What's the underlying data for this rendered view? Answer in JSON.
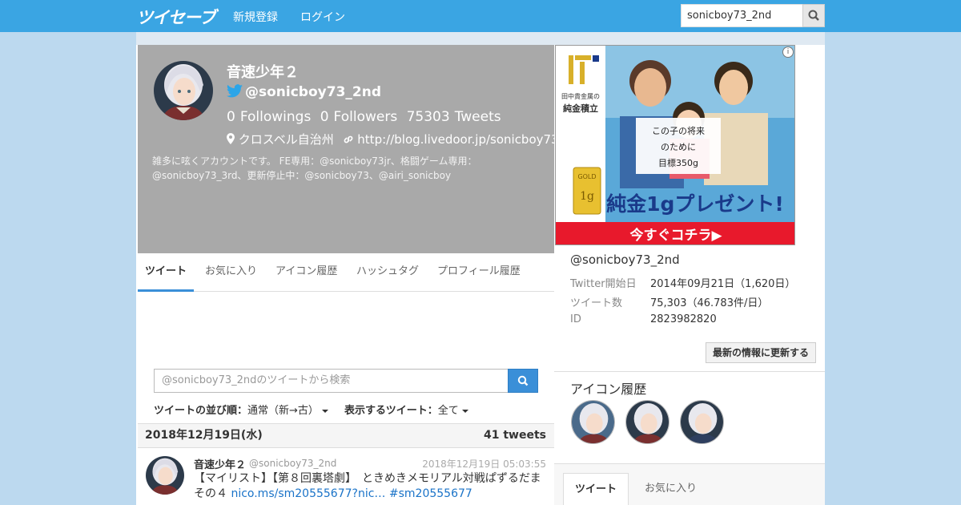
{
  "nav": {
    "brand": "ツイセーブ",
    "links": [
      "新規登録",
      "ログイン"
    ],
    "search_value": "sonicboy73_2nd"
  },
  "profile": {
    "name": "音速少年２",
    "handle": "@sonicboy73_2nd",
    "followings": "0",
    "followings_label": "Followings",
    "followers": "0",
    "followers_label": "Followers",
    "tweets": "75303",
    "tweets_label": "Tweets",
    "location": "クロスベル自治州",
    "url": "http://blog.livedoor.jp/sonicboy73",
    "bio": "雑多に呟くアカウントです。 FE専用：@sonicboy73jr、格闘ゲーム専用：@sonicboy73_3rd、更新停止中：@sonicboy73、@airi_sonicboy"
  },
  "tabs": [
    "ツイート",
    "お気に入り",
    "アイコン履歴",
    "ハッシュタグ",
    "プロフィール履歴"
  ],
  "tweet_search": {
    "placeholder": "@sonicboy73_2ndのツイートから検索"
  },
  "filters": {
    "sort_label": "ツイートの並び順：",
    "sort_value": "通常（新→古）",
    "show_label": "表示するツイート：",
    "show_value": "全て"
  },
  "date_bar": {
    "date": "2018年12月19日(水)",
    "count": "41 tweets"
  },
  "tweet": {
    "name": "音速少年２",
    "handle": "@sonicboy73_2nd",
    "time": "2018年12月19日 05:03:55",
    "text": "【マイリスト】【第８回裏塔劇】　ときめきメモリアル対戦ぱずるだまその４",
    "link1": "nico.ms/sm20555677?nic…",
    "link2": "#sm20555677"
  },
  "ad": {
    "brand_line": "田中貴金属の",
    "brand_name": "純金積立",
    "copy": "この子の将来のために目標350g",
    "bar_label": "GOLD",
    "bar_weight": "1g",
    "headline": "純金1gプレゼント!",
    "cta": "今すぐコチラ▶",
    "info": "i"
  },
  "side": {
    "handle": "@sonicboy73_2nd",
    "rows": [
      {
        "k": "Twitter開始日",
        "v": "2014年09月21日（1,620日）"
      },
      {
        "k": "ツイート数",
        "v": "75,303（46.783件/日）"
      },
      {
        "k": "ID",
        "v": "2823982820"
      }
    ],
    "refresh": "最新の情報に更新する",
    "icon_history": "アイコン履歴",
    "bottom_tabs": [
      "ツイート",
      "お気に入り"
    ]
  },
  "colors": {
    "navbar": "#3aa5e3",
    "background": "#bcd9ef",
    "profile_bg": "#a9a9a9",
    "accent": "#3a8fd8",
    "ad_red": "#e8192c"
  }
}
